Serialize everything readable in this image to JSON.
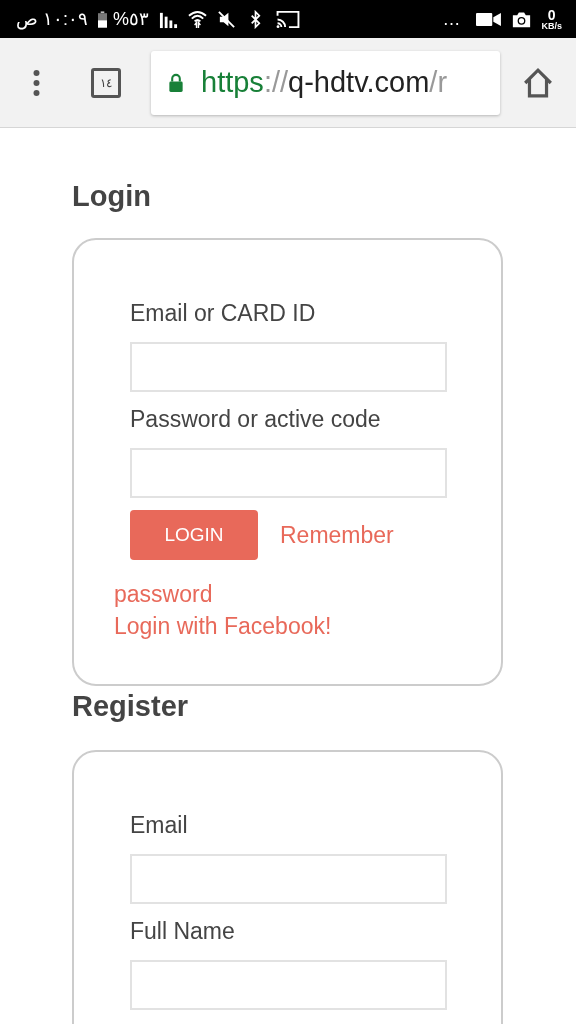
{
  "status_bar": {
    "time": "١٠:٠٩ ص",
    "battery": "%٥٣",
    "more": "…",
    "speed_value": "0",
    "speed_unit": "KB/s"
  },
  "browser_toolbar": {
    "tab_count": "١٤",
    "url": {
      "scheme": "https",
      "separator": "://",
      "host": "q-hdtv.com",
      "path": "/r"
    }
  },
  "login": {
    "title": "Login",
    "fields": [
      {
        "label": "Email or CARD ID"
      },
      {
        "label": "Password or active code"
      }
    ],
    "button": "LOGIN",
    "remember_link": [
      "Remember",
      "password"
    ],
    "facebook_link": "Login with Facebook!"
  },
  "register": {
    "title": "Register",
    "fields": [
      {
        "label": "Email"
      },
      {
        "label": "Full Name"
      }
    ]
  }
}
